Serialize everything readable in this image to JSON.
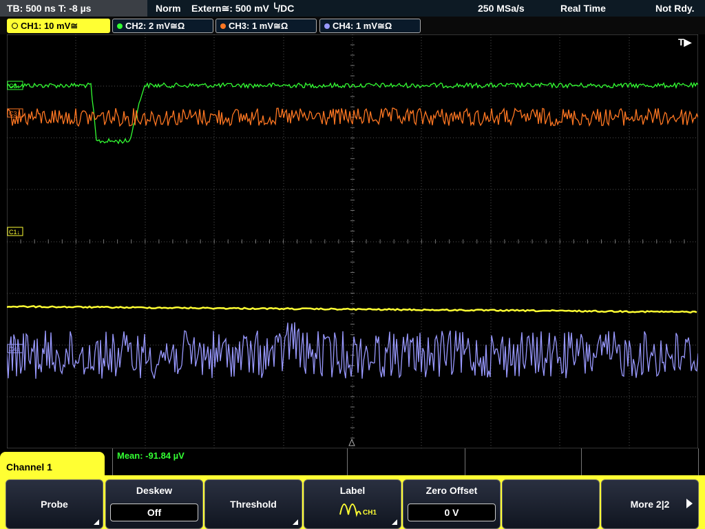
{
  "top": {
    "timebase": "TB: 500 ns   T: -8 µs",
    "mode": "Norm",
    "trigger": "Extern≅: 500 mV ╰/DC",
    "sample_rate": "250 MSa/s",
    "acq": "Real Time",
    "status": "Not Rdy."
  },
  "channels": [
    {
      "label": "CH1: 10 mV≅",
      "color": "#ffff33"
    },
    {
      "label": "CH2: 2 mV≅Ω",
      "color": "#33ff33"
    },
    {
      "label": "CH3: 1 mV≅Ω",
      "color": "#ff7722"
    },
    {
      "label": "CH4: 1 mV≅Ω",
      "color": "#9999ff"
    }
  ],
  "trigger_marker": "T▶",
  "markers": {
    "c1": "C1↓",
    "c2": "C2↓",
    "c3": "C3↓",
    "c4": "C4↓"
  },
  "measurement": "Mean: -91.84 µV",
  "channel_tab": "Channel 1",
  "softkeys": {
    "probe": "Probe",
    "deskew": "Deskew",
    "deskew_val": "Off",
    "threshold": "Threshold",
    "label": "Label",
    "label_sub": "CH1",
    "zero_offset": "Zero Offset",
    "zero_offset_val": "0 V",
    "more": "More 2|2"
  }
}
